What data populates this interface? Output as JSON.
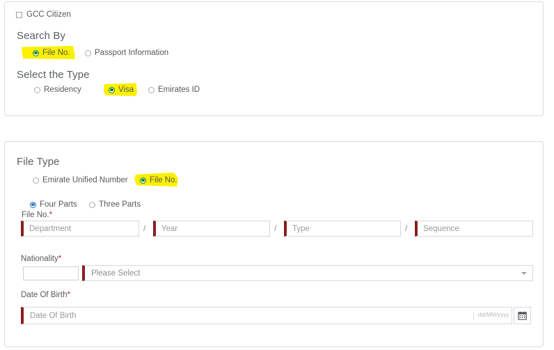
{
  "search_panel": {
    "gcc_checkbox": {
      "label": "GCC Citizen",
      "checked": false
    },
    "search_by": {
      "title": "Search By",
      "options": [
        {
          "label": "File No.",
          "selected": true,
          "highlighted": true
        },
        {
          "label": "Passport Information",
          "selected": false,
          "highlighted": false
        }
      ]
    },
    "select_type": {
      "title": "Select the Type",
      "options": [
        {
          "label": "Residency",
          "selected": false,
          "highlighted": false
        },
        {
          "label": "Visa",
          "selected": true,
          "highlighted": true
        },
        {
          "label": "Emirates ID",
          "selected": false,
          "highlighted": false
        }
      ]
    }
  },
  "file_type_panel": {
    "title": "File Type",
    "type_options": [
      {
        "label": "Emirate Unified Number",
        "selected": false,
        "highlighted": false
      },
      {
        "label": "File No.",
        "selected": true,
        "highlighted": true
      }
    ],
    "parts_options": [
      {
        "label": "Four Parts",
        "selected": true
      },
      {
        "label": "Three Parts",
        "selected": false
      }
    ],
    "file_no": {
      "label": "File No.",
      "required_mark": "*",
      "separator": "/",
      "fields": [
        {
          "placeholder": "Department",
          "value": ""
        },
        {
          "placeholder": "Year",
          "value": ""
        },
        {
          "placeholder": "Type",
          "value": ""
        },
        {
          "placeholder": "Sequence",
          "value": ""
        }
      ]
    },
    "nationality": {
      "label": "Nationality",
      "required_mark": "*",
      "code_value": "",
      "selected_option": "Please Select"
    },
    "date_of_birth": {
      "label": "Date Of Birth",
      "required_mark": "*",
      "placeholder": "Date Of Birth",
      "value": "",
      "format_hint": "dd/MM/yyyy",
      "calendar_icon": "calendar-icon"
    }
  },
  "colors": {
    "highlight": "#fbf000",
    "required_border": "#8a1f1f",
    "selected_green": "#0b8a16",
    "selected_blue": "#2a7ad4"
  }
}
